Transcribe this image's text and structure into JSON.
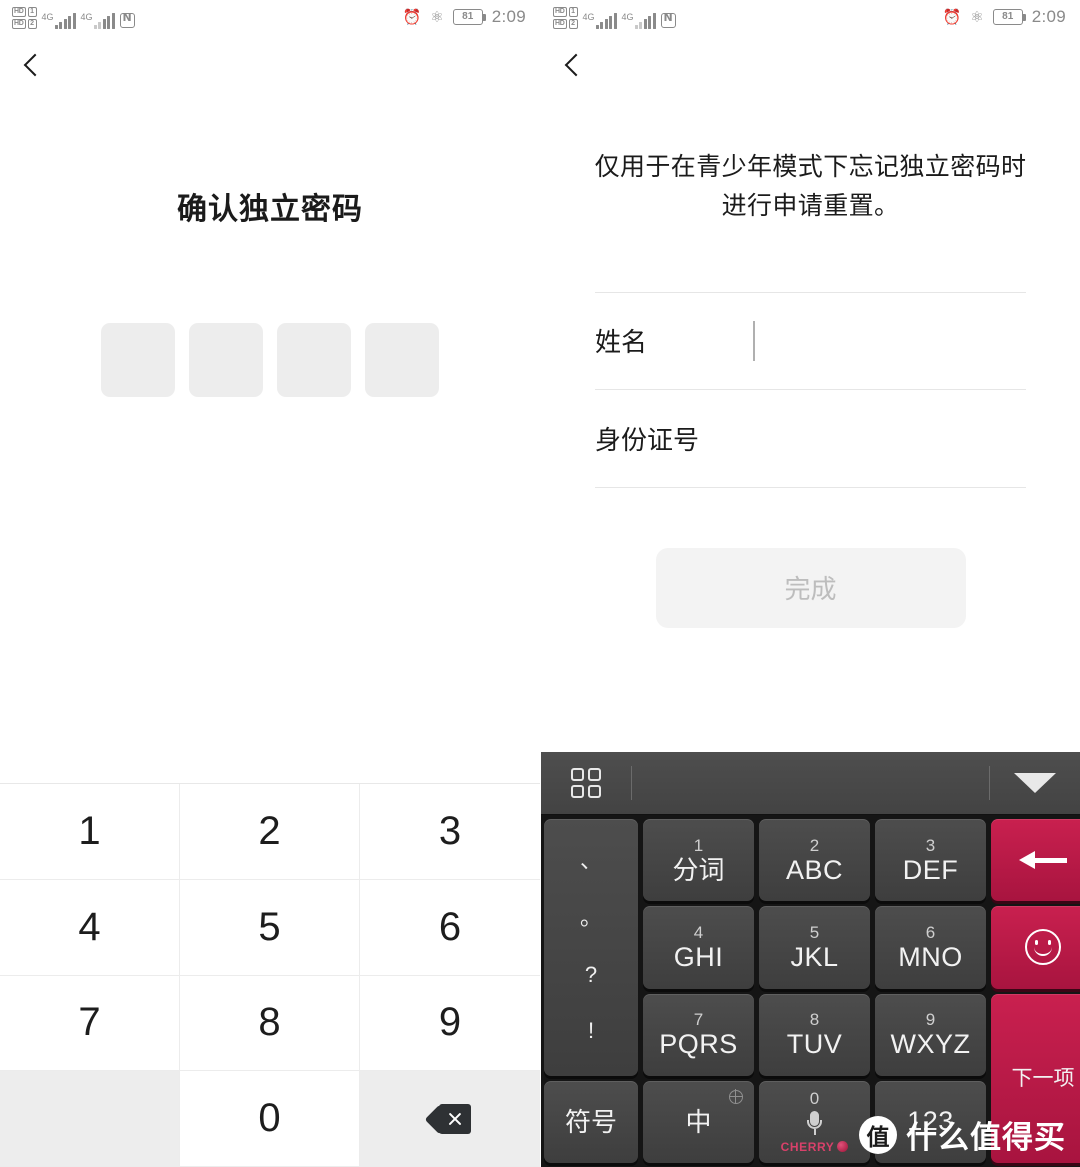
{
  "status_bar": {
    "hd_label": "HD",
    "sim1": "1",
    "sim2": "2",
    "network_1": "4G",
    "network_2": "4G",
    "nfc_icon": "nfc-icon",
    "alarm_icon": "alarm-icon",
    "bluetooth_icon": "bluetooth-icon",
    "battery_level": "81",
    "time": "2:09"
  },
  "left_panel": {
    "back_icon": "back-chevron-icon",
    "title": "确认独立密码",
    "pin_boxes": [
      "",
      "",
      "",
      ""
    ],
    "keypad": {
      "keys": [
        "1",
        "2",
        "3",
        "4",
        "5",
        "6",
        "7",
        "8",
        "9"
      ],
      "blank": "",
      "zero": "0",
      "delete_icon": "backspace-icon"
    }
  },
  "right_panel": {
    "back_icon": "back-chevron-icon",
    "description": "仅用于在青少年模式下忘记独立密码时进行申请重置。",
    "form": {
      "fields": [
        {
          "label": "姓名",
          "value": "",
          "placeholder": "",
          "focused": true
        },
        {
          "label": "身份证号",
          "value": "",
          "placeholder": "",
          "focused": false
        }
      ]
    },
    "submit_label": "完成",
    "submit_disabled": true,
    "keyboard": {
      "toolbar": {
        "grid_icon": "keyboard-panel-grid-icon",
        "collapse_icon": "collapse-keyboard-icon"
      },
      "punct_key": [
        "、",
        "。",
        "?",
        "!"
      ],
      "keys": [
        {
          "num": "1",
          "label": "分词",
          "type": "cn"
        },
        {
          "num": "2",
          "label": "ABC",
          "type": "alpha"
        },
        {
          "num": "3",
          "label": "DEF",
          "type": "alpha"
        },
        {
          "num": "4",
          "label": "GHI",
          "type": "alpha"
        },
        {
          "num": "5",
          "label": "JKL",
          "type": "alpha"
        },
        {
          "num": "6",
          "label": "MNO",
          "type": "alpha"
        },
        {
          "num": "7",
          "label": "PQRS",
          "type": "alpha"
        },
        {
          "num": "8",
          "label": "TUV",
          "type": "alpha"
        },
        {
          "num": "9",
          "label": "WXYZ",
          "type": "alpha"
        }
      ],
      "symbol_key": "符号",
      "lang_key": "中",
      "lang_badge_icon": "globe-icon",
      "space_key": {
        "num": "0",
        "mic_icon": "microphone-icon",
        "brand": "CHERRY"
      },
      "numeric_key": "123",
      "backspace_icon": "backspace-arrow-icon",
      "emoji_icon": "smiley-icon",
      "next_key": "下一项"
    }
  },
  "watermark": {
    "logo": "值",
    "text": "什么值得买"
  },
  "colors": {
    "accent_red": "#c9204f",
    "key_gray": "#4d4d4d",
    "keyboard_bg": "#151515",
    "toolbar_gray": "#4a4a4a",
    "pin_box": "#ededed",
    "disabled_text": "#bdbdbd"
  }
}
